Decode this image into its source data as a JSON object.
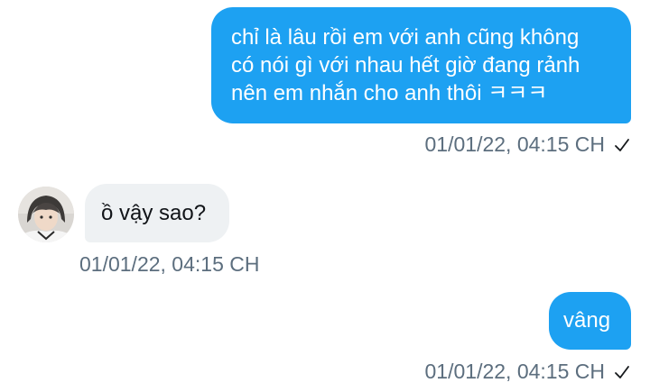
{
  "conversation": {
    "messages": [
      {
        "direction": "outgoing",
        "lines": [
          "chỉ là lâu rồi em với anh cũng không",
          "có nói gì với nhau hết giờ đang rảnh",
          "nên em nhắn cho anh thôi ㅋㅋㅋ"
        ],
        "timestamp": "01/01/22, 04:15 CH",
        "status_icon": "check-icon"
      },
      {
        "direction": "incoming",
        "text": "ồ vậy sao?",
        "timestamp": "01/01/22, 04:15 CH",
        "avatar_icon": "avatar"
      },
      {
        "direction": "outgoing",
        "text": "vâng",
        "timestamp": "01/01/22, 04:15 CH",
        "status_icon": "check-icon"
      }
    ]
  },
  "colors": {
    "outgoing_bubble": "#1da1f2",
    "incoming_bubble": "#eef1f3",
    "timestamp_text": "#5c6e7e"
  }
}
